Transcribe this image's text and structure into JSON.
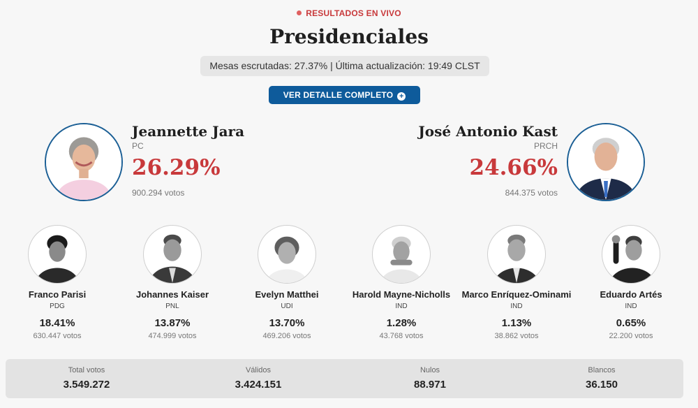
{
  "header": {
    "live_label": "RESULTADOS EN VIVO",
    "title": "Presidenciales",
    "status": "Mesas escrutadas: 27.37% | Última actualización: 19:49 CLST",
    "detail_button": "VER DETALLE COMPLETO"
  },
  "leaders": [
    {
      "name": "Jeannette Jara",
      "party": "PC",
      "percent": "26.29%",
      "votes": "900.294 votos"
    },
    {
      "name": "José Antonio Kast",
      "party": "PRCH",
      "percent": "24.66%",
      "votes": "844.375 votos"
    }
  ],
  "candidates": [
    {
      "name": "Franco Parisi",
      "party": "PDG",
      "percent": "18.41%",
      "votes": "630.447 votos"
    },
    {
      "name": "Johannes Kaiser",
      "party": "PNL",
      "percent": "13.87%",
      "votes": "474.999 votos"
    },
    {
      "name": "Evelyn Matthei",
      "party": "UDI",
      "percent": "13.70%",
      "votes": "469.206 votos"
    },
    {
      "name": "Harold Mayne-Nicholls",
      "party": "IND",
      "percent": "1.28%",
      "votes": "43.768 votos"
    },
    {
      "name": "Marco Enríquez-Ominami",
      "party": "IND",
      "percent": "1.13%",
      "votes": "38.862 votos"
    },
    {
      "name": "Eduardo Artés",
      "party": "IND",
      "percent": "0.65%",
      "votes": "22.200 votos"
    }
  ],
  "totals": [
    {
      "label": "Total votos",
      "value": "3.549.272"
    },
    {
      "label": "Válidos",
      "value": "3.424.151"
    },
    {
      "label": "Nulos",
      "value": "88.971"
    },
    {
      "label": "Blancos",
      "value": "36.150"
    }
  ],
  "colors": {
    "accent_red": "#c8393b",
    "button_blue": "#0e5b9b",
    "photo_ring": "#1b5f95"
  }
}
